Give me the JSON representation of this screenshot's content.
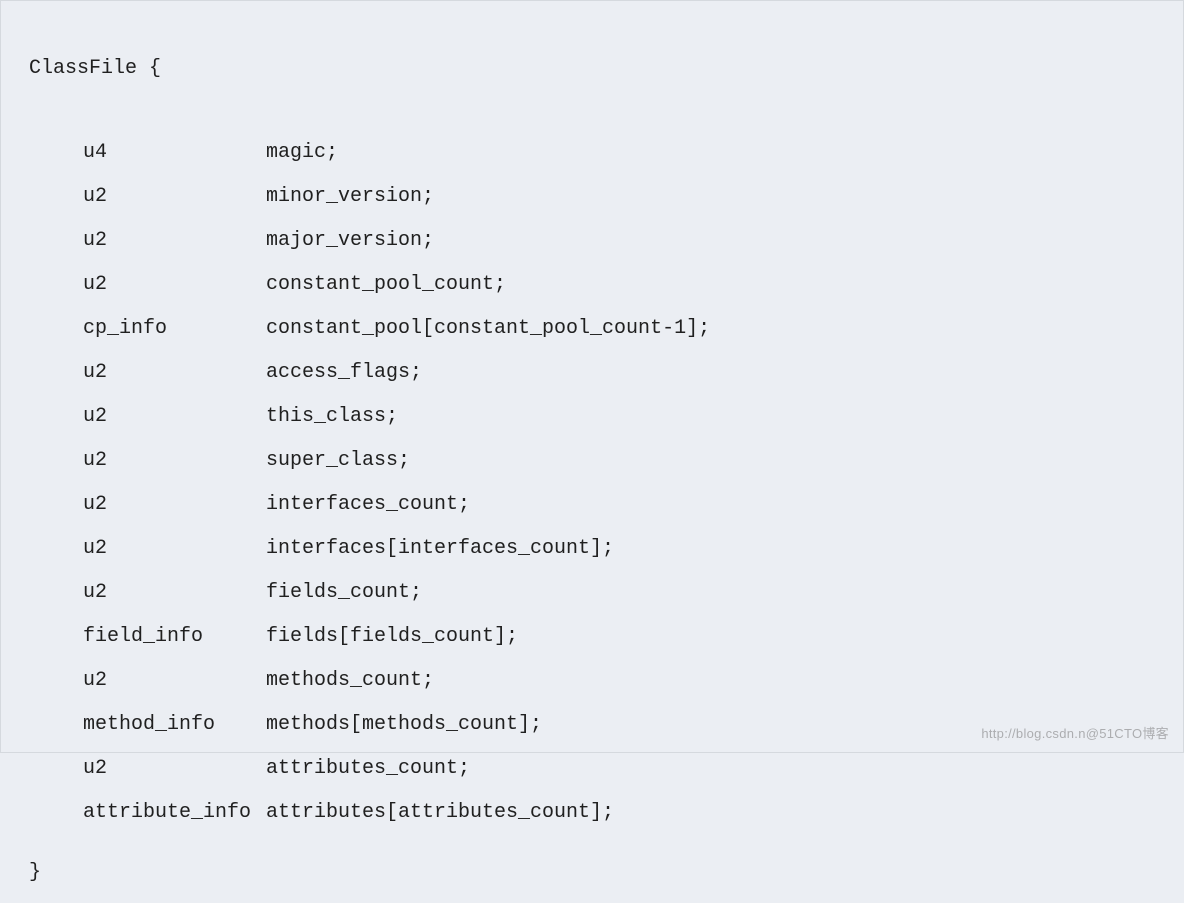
{
  "code": {
    "header": "ClassFile {",
    "footer": "}",
    "fields": [
      {
        "type": "u4",
        "name": "magic;"
      },
      {
        "type": "u2",
        "name": "minor_version;"
      },
      {
        "type": "u2",
        "name": "major_version;"
      },
      {
        "type": "u2",
        "name": "constant_pool_count;"
      },
      {
        "type": "cp_info",
        "name": "constant_pool[constant_pool_count-1];"
      },
      {
        "type": "u2",
        "name": "access_flags;"
      },
      {
        "type": "u2",
        "name": "this_class;"
      },
      {
        "type": "u2",
        "name": "super_class;"
      },
      {
        "type": "u2",
        "name": "interfaces_count;"
      },
      {
        "type": "u2",
        "name": "interfaces[interfaces_count];"
      },
      {
        "type": "u2",
        "name": "fields_count;"
      },
      {
        "type": "field_info",
        "name": "fields[fields_count];"
      },
      {
        "type": "u2",
        "name": "methods_count;"
      },
      {
        "type": "method_info",
        "name": "methods[methods_count];"
      },
      {
        "type": "u2",
        "name": "attributes_count;"
      },
      {
        "type": "attribute_info",
        "name": "attributes[attributes_count];"
      }
    ]
  },
  "watermark": "http://blog.csdn.n@51CTO博客"
}
